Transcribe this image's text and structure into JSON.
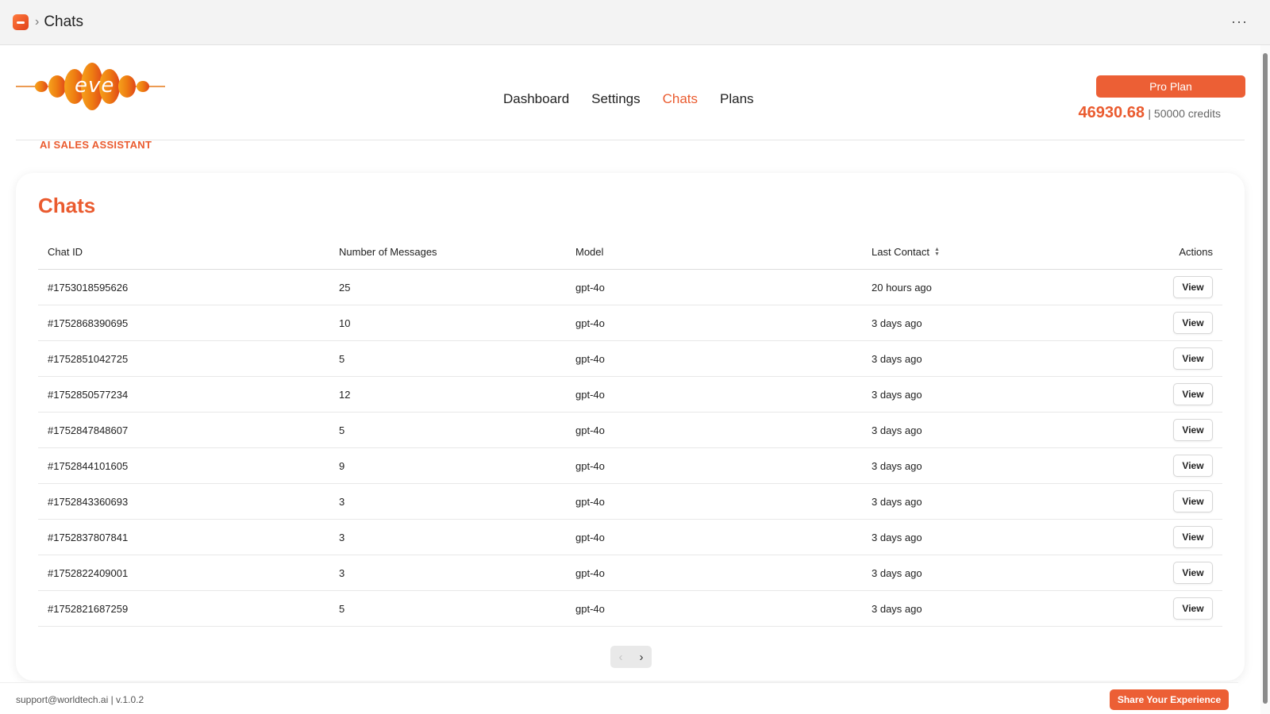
{
  "window": {
    "title": "Chats",
    "more_icon": "more-horizontal-icon"
  },
  "brand": {
    "logo_text": "eve",
    "tagline": "AI SALES ASSISTANT",
    "colors": {
      "accent": "#ea5b2f",
      "button": "#ec5f35"
    }
  },
  "nav": {
    "items": [
      {
        "label": "Dashboard",
        "active": false
      },
      {
        "label": "Settings",
        "active": false
      },
      {
        "label": "Chats",
        "active": true
      },
      {
        "label": "Plans",
        "active": false
      }
    ]
  },
  "plan": {
    "button_label": "Pro Plan",
    "credits_used": "46930.68",
    "credits_total": "| 50000 credits"
  },
  "chats": {
    "title": "Chats",
    "columns": [
      "Chat ID",
      "Number of Messages",
      "Model",
      "Last Contact",
      "Actions"
    ],
    "rows": [
      {
        "id": "#1753018595626",
        "messages": "25",
        "model": "gpt-4o",
        "last_contact": "20 hours ago",
        "action": "View"
      },
      {
        "id": "#1752868390695",
        "messages": "10",
        "model": "gpt-4o",
        "last_contact": "3 days ago",
        "action": "View"
      },
      {
        "id": "#1752851042725",
        "messages": "5",
        "model": "gpt-4o",
        "last_contact": "3 days ago",
        "action": "View"
      },
      {
        "id": "#1752850577234",
        "messages": "12",
        "model": "gpt-4o",
        "last_contact": "3 days ago",
        "action": "View"
      },
      {
        "id": "#1752847848607",
        "messages": "5",
        "model": "gpt-4o",
        "last_contact": "3 days ago",
        "action": "View"
      },
      {
        "id": "#1752844101605",
        "messages": "9",
        "model": "gpt-4o",
        "last_contact": "3 days ago",
        "action": "View"
      },
      {
        "id": "#1752843360693",
        "messages": "3",
        "model": "gpt-4o",
        "last_contact": "3 days ago",
        "action": "View"
      },
      {
        "id": "#1752837807841",
        "messages": "3",
        "model": "gpt-4o",
        "last_contact": "3 days ago",
        "action": "View"
      },
      {
        "id": "#1752822409001",
        "messages": "3",
        "model": "gpt-4o",
        "last_contact": "3 days ago",
        "action": "View"
      },
      {
        "id": "#1752821687259",
        "messages": "5",
        "model": "gpt-4o",
        "last_contact": "3 days ago",
        "action": "View"
      }
    ],
    "pagination": {
      "prev_icon": "chevron-left-icon",
      "next_icon": "chevron-right-icon"
    }
  },
  "footer": {
    "text": "support@worldtech.ai | v.1.0.2",
    "share_label": "Share Your Experience"
  }
}
